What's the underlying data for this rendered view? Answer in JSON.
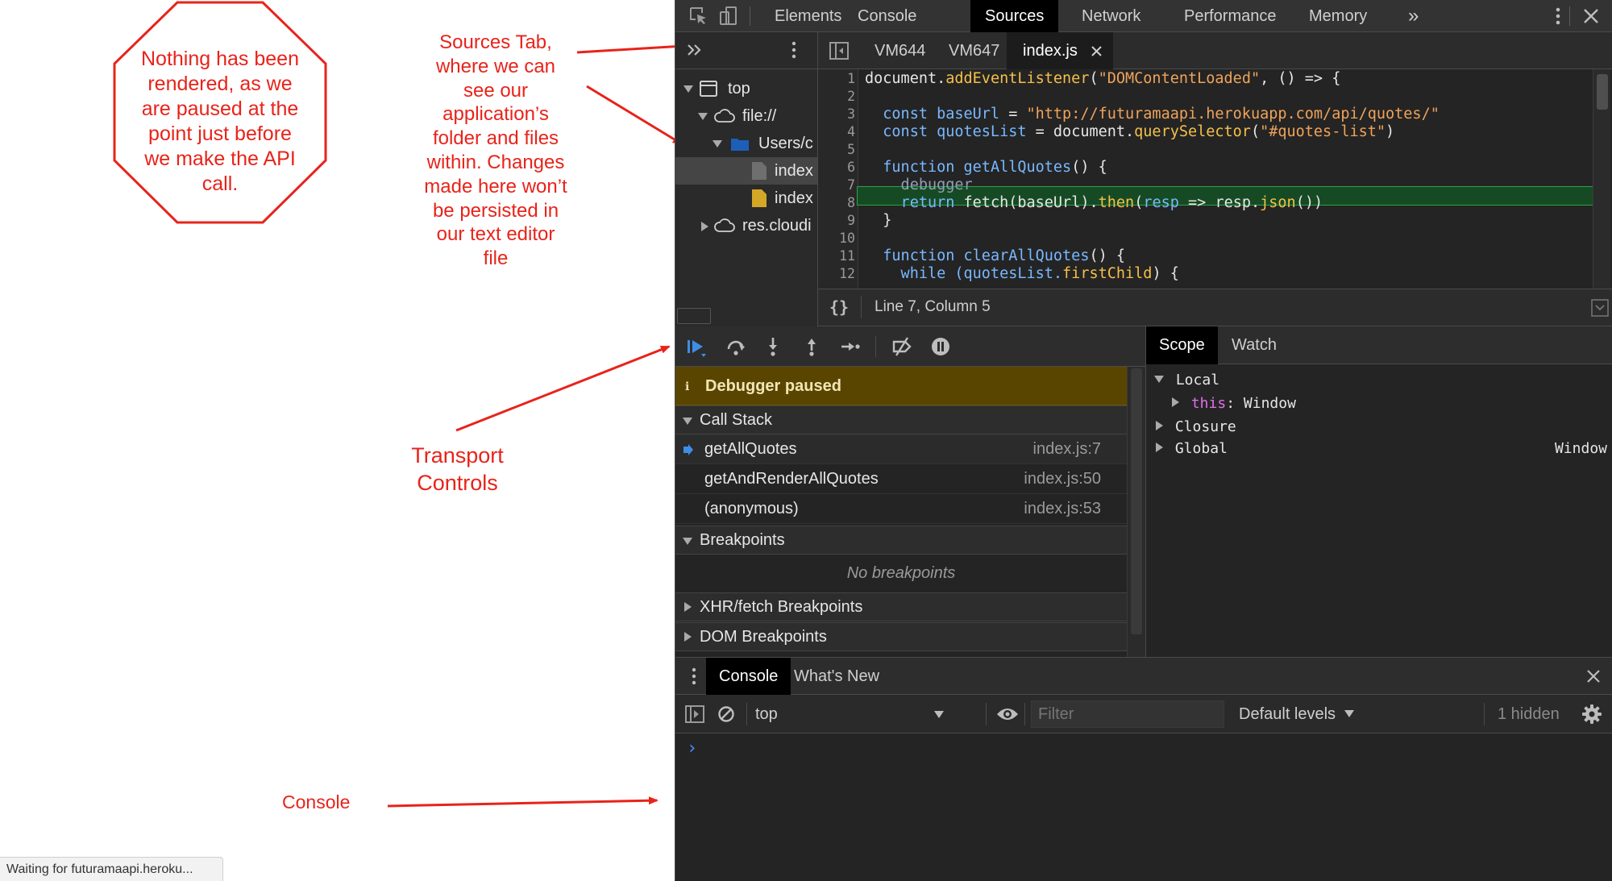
{
  "annotations": {
    "octagon_lines": [
      "Nothing has been",
      "rendered, as we",
      "are paused at the",
      "point just before",
      "we make the API",
      "call."
    ],
    "sources_lines": [
      "Sources Tab,",
      "where we can",
      "see our",
      "application’s",
      "folder and files",
      "within.  Changes",
      "made here won’t",
      "be persisted in",
      "our text editor",
      "file"
    ],
    "transport_lines": [
      "Transport",
      "Controls"
    ],
    "console_label": "Console",
    "color": "#e8231a"
  },
  "browser_status": "Waiting for futuramaapi.heroku...",
  "devtools": {
    "tabs": [
      "Elements",
      "Console",
      "Sources",
      "Network",
      "Performance",
      "Memory"
    ],
    "active_tab": "Sources",
    "more_tabs_glyph": "»",
    "navigator": {
      "tree": [
        {
          "label": "top",
          "icon": "frame-icon"
        },
        {
          "label": "file://",
          "icon": "cloud-icon"
        },
        {
          "label": "Users/c",
          "icon": "folder-icon"
        },
        {
          "label": "index",
          "icon": "html-file-icon"
        },
        {
          "label": "index",
          "icon": "js-file-icon"
        },
        {
          "label": "res.cloudi",
          "icon": "cloud-icon"
        }
      ]
    },
    "editor_tabs": [
      "VM644",
      "VM647",
      "index.js"
    ],
    "active_editor_tab": "index.js",
    "code_lines": {
      "l1": {
        "n": "1",
        "a": "document.",
        "b": "addEventListener",
        "c": "(",
        "d": "\"DOMContentLoaded\"",
        "e": ", () => {"
      },
      "l2": {
        "n": "2"
      },
      "l3": {
        "n": "3",
        "a": "  const ",
        "b": "baseUrl",
        "c": " = ",
        "d": "\"http://futuramaapi.herokuapp.com/api/quotes/\""
      },
      "l4": {
        "n": "4",
        "a": "  const ",
        "b": "quotesList",
        "c": " = document.",
        "d": "querySelector",
        "e": "(",
        "f": "\"#quotes-list\"",
        "g": ")"
      },
      "l5": {
        "n": "5"
      },
      "l6": {
        "n": "6",
        "a": "  function ",
        "b": "getAllQuotes",
        "c": "() {"
      },
      "l7": {
        "n": "7",
        "a": "    debugger"
      },
      "l8": {
        "n": "8",
        "a": "    return ",
        "b": "fetch",
        "c": "(baseUrl).",
        "d": "then",
        "e": "(",
        "f": "resp",
        "g": " => resp.",
        "h": "json",
        "i": "())"
      },
      "l9": {
        "n": "9",
        "a": "  }"
      },
      "l10": {
        "n": "10"
      },
      "l11": {
        "n": "11",
        "a": "  function ",
        "b": "clearAllQuotes",
        "c": "() {"
      },
      "l12": {
        "n": "12",
        "a": "    while (quotesList.",
        "b": "firstChild",
        "c": ") {"
      }
    },
    "cursor_position": "Line 7, Column 5",
    "pretty_print_glyph": "{}",
    "debugger_paused": "Debugger paused",
    "call_stack_label": "Call Stack",
    "call_stack": [
      {
        "fn": "getAllQuotes",
        "loc": "index.js:7"
      },
      {
        "fn": "getAndRenderAllQuotes",
        "loc": "index.js:50"
      },
      {
        "fn": "(anonymous)",
        "loc": "index.js:53"
      }
    ],
    "breakpoints_label": "Breakpoints",
    "no_breakpoints": "No breakpoints",
    "xhr_breakpoints_label": "XHR/fetch Breakpoints",
    "dom_breakpoints_label": "DOM Breakpoints",
    "scope_tabs": [
      "Scope",
      "Watch"
    ],
    "scope": {
      "local": "Local",
      "this_key": "this",
      "this_sep": ": ",
      "this_val": "Window",
      "closure": "Closure",
      "global": "Global",
      "global_val": "Window"
    },
    "drawer_tabs": [
      "Console",
      "What's New"
    ],
    "console": {
      "context": "top",
      "filter_placeholder": "Filter",
      "levels": "Default levels",
      "hidden": "1 hidden",
      "prompt": "›"
    }
  }
}
